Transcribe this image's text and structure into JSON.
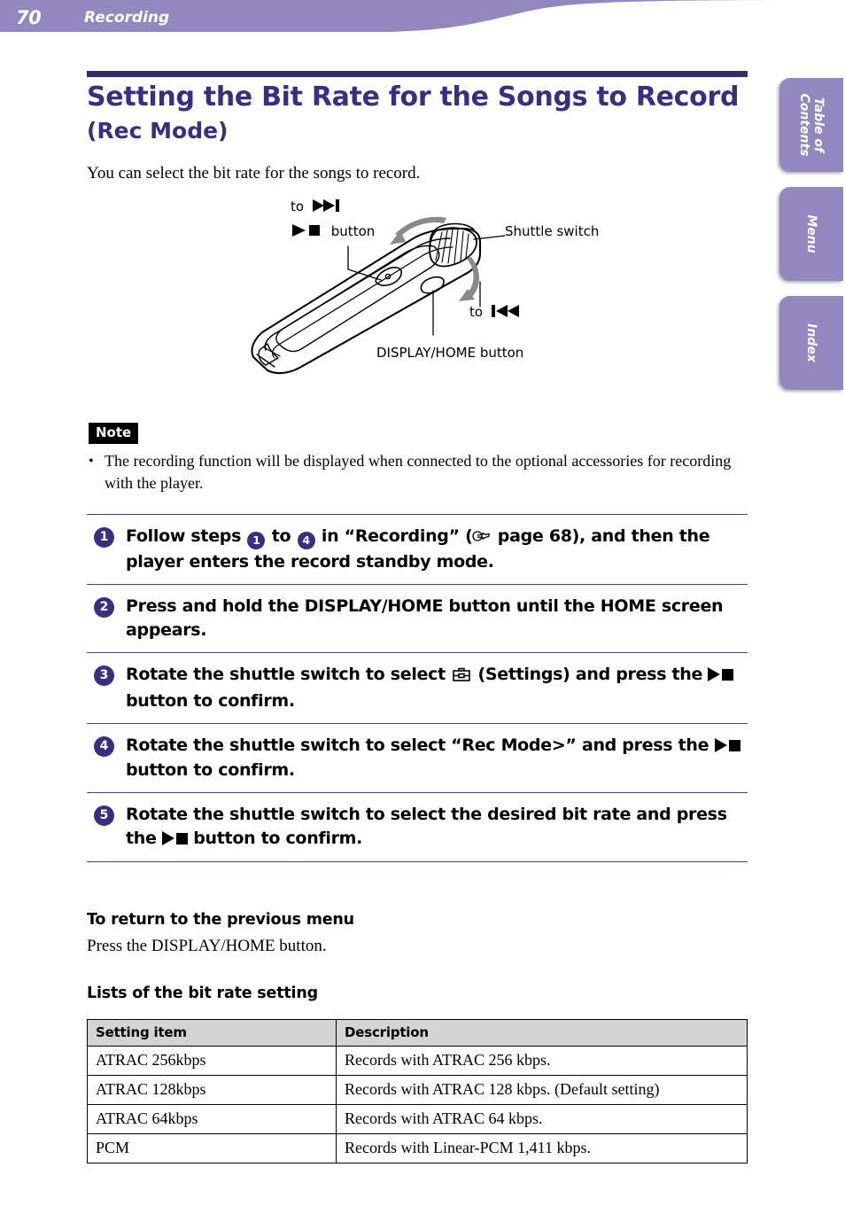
{
  "header": {
    "page_number": "70",
    "section": "Recording",
    "band_color": "#9288bf"
  },
  "side_tabs": [
    {
      "label": "Table of\nContents",
      "name": "table-of-contents"
    },
    {
      "label": "Menu",
      "name": "menu"
    },
    {
      "label": "Index",
      "name": "index"
    }
  ],
  "title": {
    "main": "Setting the Bit Rate for the Songs to Record",
    "sub": "(Rec Mode)",
    "color": "#3b2d80"
  },
  "intro": "You can select the bit rate for the songs to record.",
  "illustration": {
    "callouts": {
      "play_stop_button": "button",
      "shuttle_switch": "Shuttle switch",
      "display_home_button": "DISPLAY/HOME button",
      "to_forward": "to",
      "to_back": "to"
    }
  },
  "note": {
    "label": "Note",
    "bullet": "•",
    "text": "The recording function will be displayed when connected to the optional accessories for recording with the player."
  },
  "steps": [
    {
      "number": "1",
      "parts": [
        {
          "type": "text",
          "value": "Follow steps "
        },
        {
          "type": "badge",
          "value": "1"
        },
        {
          "type": "text",
          "value": " to "
        },
        {
          "type": "badge",
          "value": "4"
        },
        {
          "type": "text",
          "value": " in “Recording” ("
        },
        {
          "type": "hand-icon"
        },
        {
          "type": "text",
          "value": " page 68), and then the player enters the record standby mode."
        }
      ]
    },
    {
      "number": "2",
      "parts": [
        {
          "type": "text",
          "value": "Press and hold the DISPLAY/HOME button until the HOME screen appears."
        }
      ]
    },
    {
      "number": "3",
      "parts": [
        {
          "type": "text",
          "value": "Rotate the shuttle switch to select "
        },
        {
          "type": "settings-icon"
        },
        {
          "type": "text",
          "value": " (Settings) and press the "
        },
        {
          "type": "play-stop"
        },
        {
          "type": "text",
          "value": " button to confirm."
        }
      ]
    },
    {
      "number": "4",
      "parts": [
        {
          "type": "text",
          "value": "Rotate the shuttle switch to select “Rec Mode>” and press the "
        },
        {
          "type": "play-stop"
        },
        {
          "type": "text",
          "value": " button to confirm."
        }
      ]
    },
    {
      "number": "5",
      "parts": [
        {
          "type": "text",
          "value": "Rotate the shuttle switch to select the desired bit rate and press the "
        },
        {
          "type": "play-stop"
        },
        {
          "type": "text",
          "value": " button to confirm."
        }
      ]
    }
  ],
  "return_section": {
    "heading": "To return to the previous menu",
    "body": "Press the DISPLAY/HOME button."
  },
  "lists_section": {
    "heading": "Lists of the bit rate setting"
  },
  "table": {
    "headers": [
      "Setting item",
      "Description"
    ],
    "rows": [
      [
        "ATRAC 256kbps",
        "Records with ATRAC 256 kbps."
      ],
      [
        "ATRAC 128kbps",
        "Records with ATRAC 128 kbps. (Default setting)"
      ],
      [
        "ATRAC 64kbps",
        "Records with ATRAC 64 kbps."
      ],
      [
        "PCM",
        "Records with Linear-PCM 1,411 kbps."
      ]
    ]
  }
}
